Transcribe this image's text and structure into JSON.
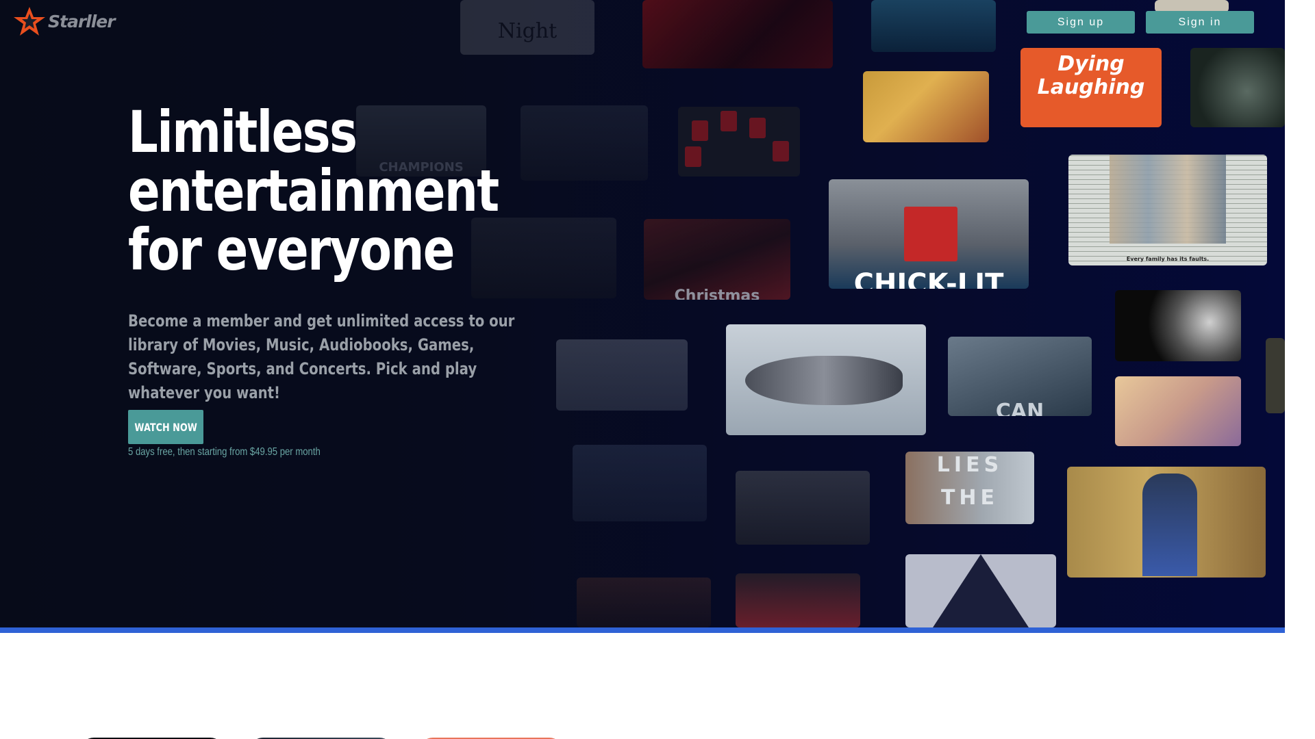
{
  "brand": {
    "name": "Starller",
    "icon": "star-logo-icon",
    "star_color": "#e94f1e",
    "text_color": "#8b8f98"
  },
  "auth": {
    "signup_label": "Sign up",
    "signin_label": "Sign in",
    "button_color": "#4a9a98"
  },
  "hero": {
    "headline": [
      "Limitless",
      "entertainment",
      "for everyone"
    ],
    "description": "Become a member and get unlimited access to our library of Movies, Music, Audiobooks, Games, Software, Sports, and Concerts. Pick and play whatever you want!",
    "cta_label": "WATCH NOW",
    "offer_text": "5 days free, then starting from $49.95 per month",
    "accent_bar_color": "#2f62d6",
    "background_color": "#070b1d"
  },
  "posters": {
    "dying_laughing": [
      "Dying",
      "Laughing"
    ],
    "chick_lit": "CHICK-LIT",
    "lies_the": [
      "LIES",
      "THE"
    ],
    "christmas": "Christmas",
    "champions": "CHAMPIONS LEAGUE",
    "night": "Night",
    "family_tagline": "Every family has its faults."
  }
}
